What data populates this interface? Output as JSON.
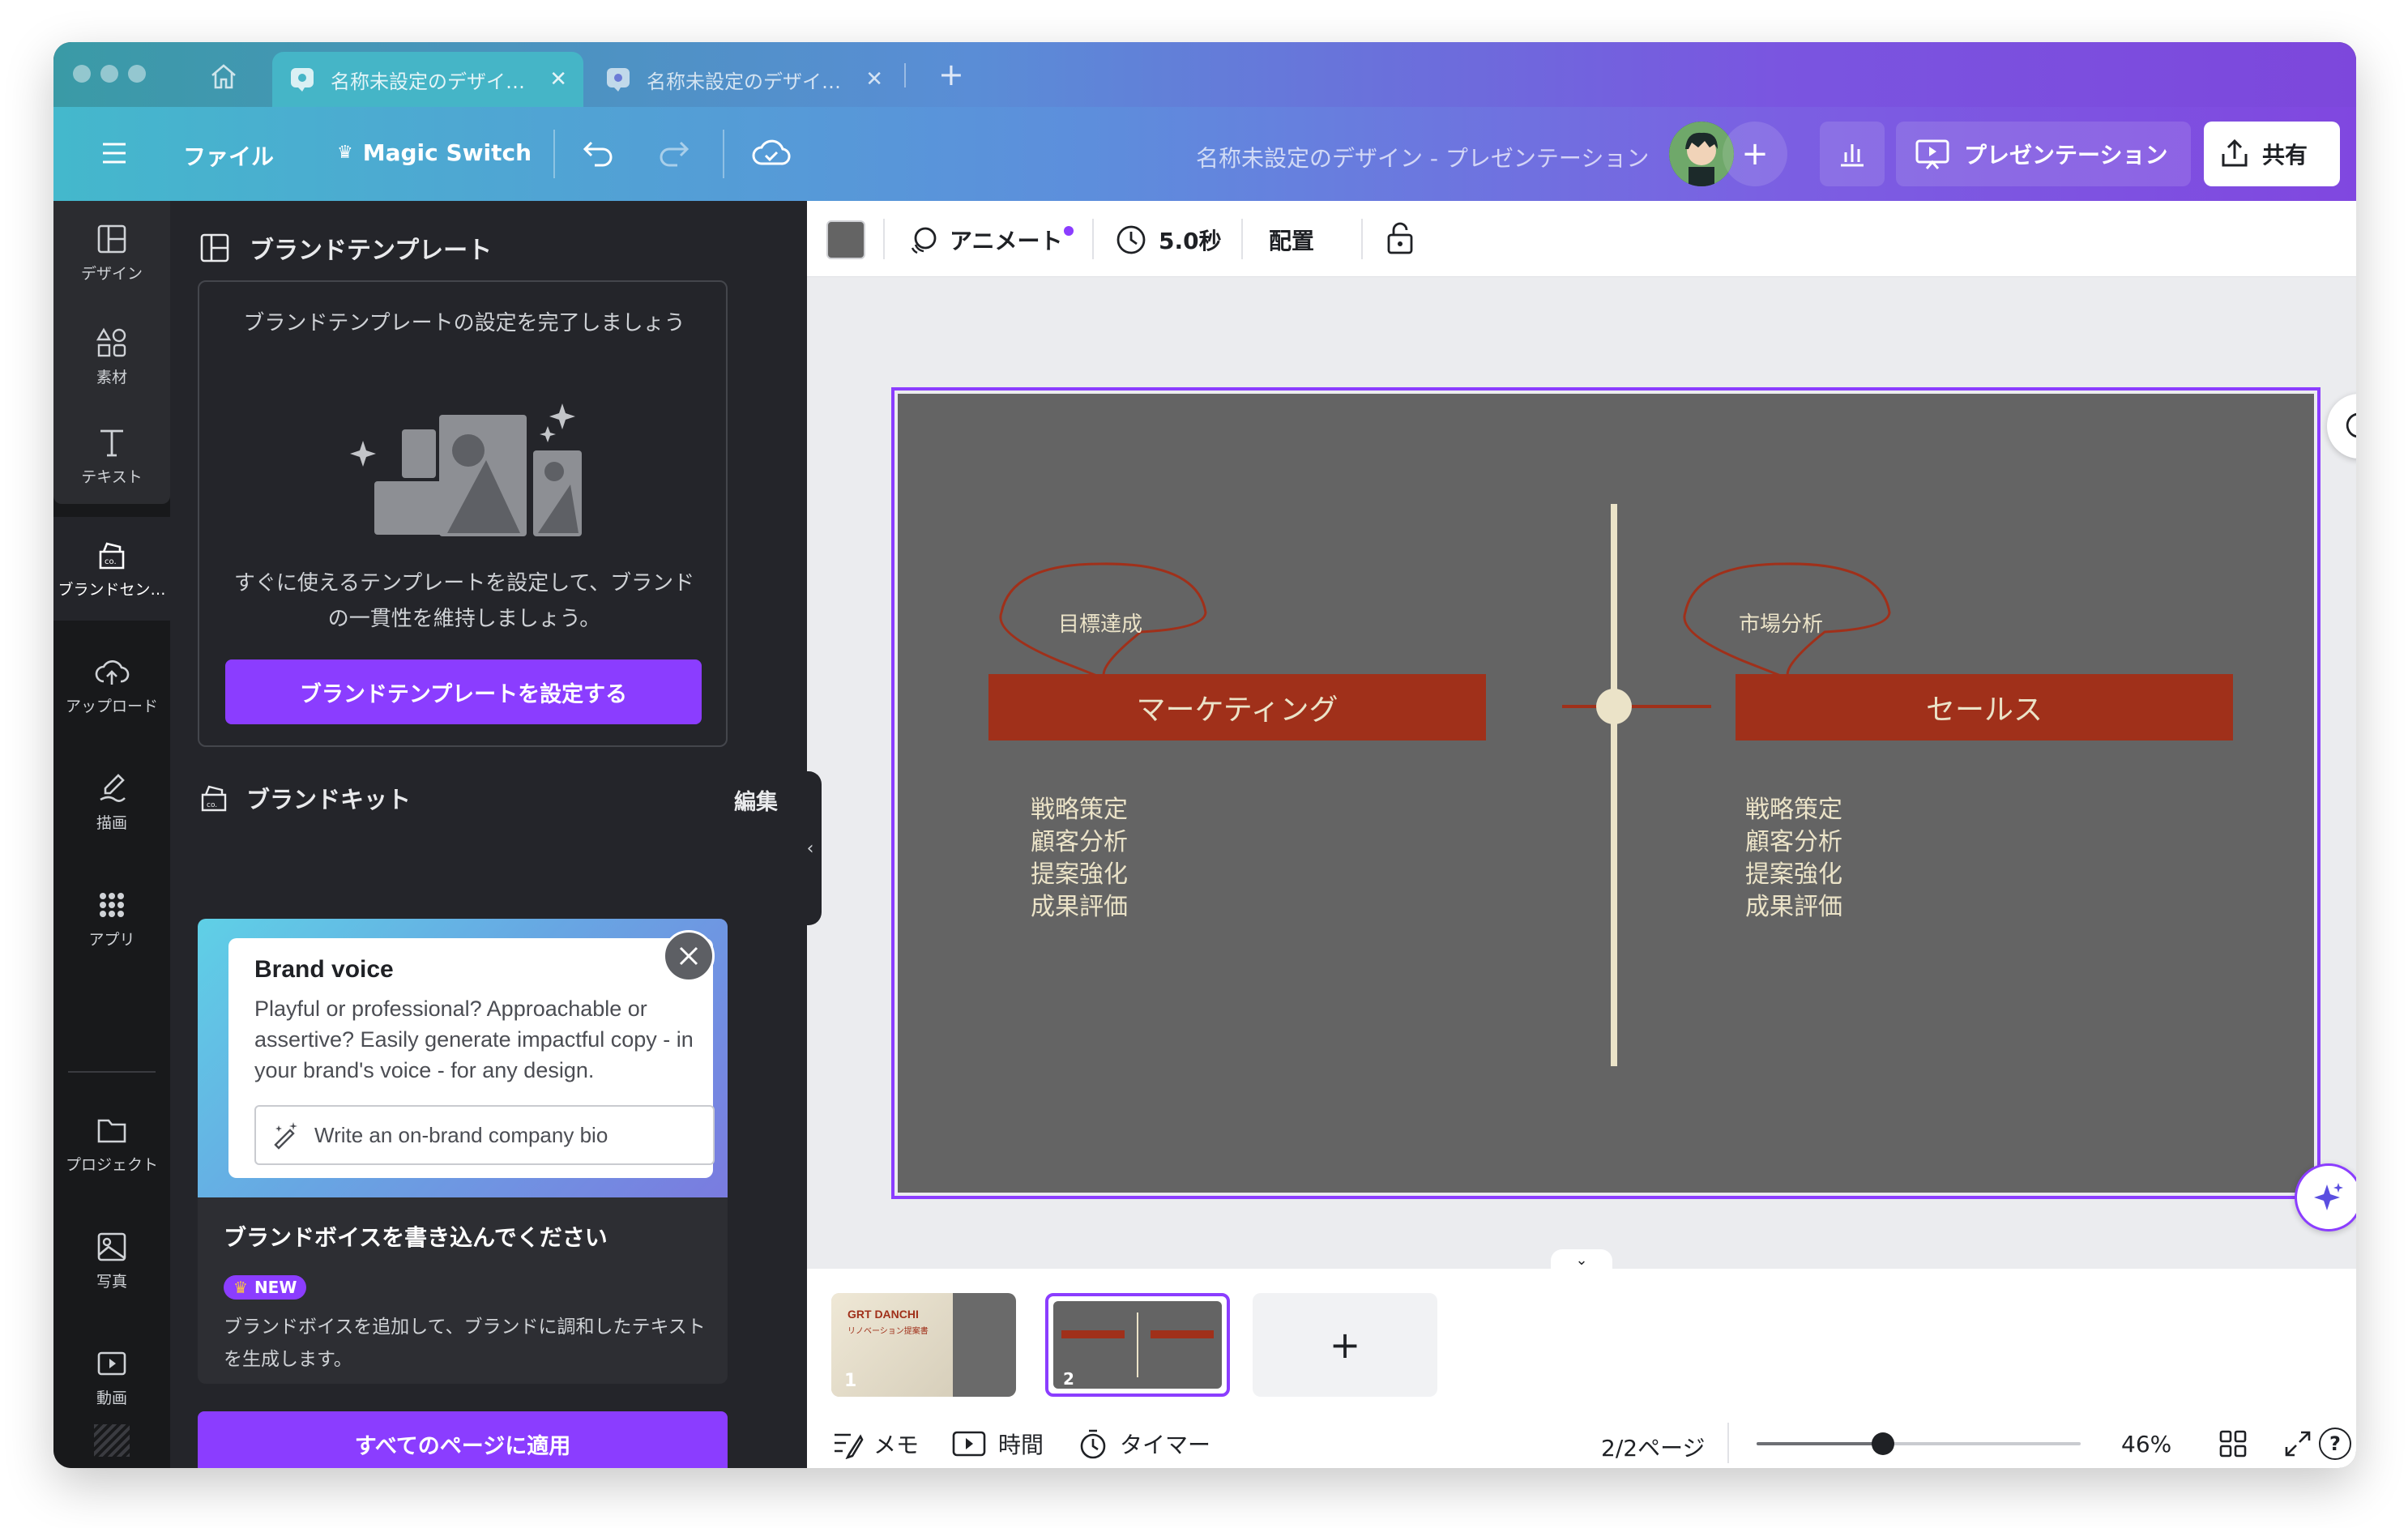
{
  "tabs": [
    {
      "label": "名称未設定のデザイ…",
      "active": true
    },
    {
      "label": "名称未設定のデザイ…",
      "active": false
    }
  ],
  "toolbar": {
    "file_label": "ファイル",
    "magic_switch_label": "Magic Switch",
    "doc_title": "名称未設定のデザイン - プレゼンテーション",
    "present_label": "プレゼンテーション",
    "share_label": "共有"
  },
  "rail": {
    "items": [
      {
        "label": "デザイン",
        "icon": "layout-icon"
      },
      {
        "label": "素材",
        "icon": "shapes-icon"
      },
      {
        "label": "テキスト",
        "icon": "text-icon"
      },
      {
        "label": "ブランドセン…",
        "icon": "brand-icon"
      },
      {
        "label": "アップロード",
        "icon": "upload-icon"
      },
      {
        "label": "描画",
        "icon": "draw-icon"
      },
      {
        "label": "アプリ",
        "icon": "apps-icon"
      },
      {
        "label": "プロジェクト",
        "icon": "folder-icon"
      },
      {
        "label": "写真",
        "icon": "photo-icon"
      },
      {
        "label": "動画",
        "icon": "video-icon"
      }
    ]
  },
  "panel": {
    "header": "ブランドテンプレート",
    "setup_title": "ブランドテンプレートの設定を完了しましょう",
    "setup_desc": "すぐに使えるテンプレートを設定して、ブランドの一貫性を維持しましょう。",
    "setup_button": "ブランドテンプレートを設定する",
    "brand_kit_label": "ブランドキット",
    "edit_label": "編集",
    "voice_card_title": "Brand voice",
    "voice_card_desc": "Playful or professional? Approachable or assertive? Easily generate impactful copy - in your brand's voice - for any design.",
    "voice_card_input": "Write an on-brand company bio",
    "voice_heading": "ブランドボイスを書き込んでください",
    "new_badge": "NEW",
    "voice_desc": "ブランドボイスを追加して、ブランドに調和したテキストを生成します。",
    "apply_button": "すべてのページに適用"
  },
  "context": {
    "animate_label": "アニメート",
    "duration_label": "5.0秒",
    "arrange_label": "配置"
  },
  "slide": {
    "left_bubble": "目標達成",
    "right_bubble": "市場分析",
    "left_header": "マーケティング",
    "right_header": "セールス",
    "left_items": [
      "戦略策定",
      "顧客分析",
      "提案強化",
      "成果評価"
    ],
    "right_items": [
      "戦略策定",
      "顧客分析",
      "提案強化",
      "成果評価"
    ],
    "bg_color": "#646464",
    "accent_color": "#a0301a",
    "line_color": "#ebe3c8"
  },
  "thumbnails": [
    {
      "number": "1",
      "title": "GRT DANCHI",
      "subtitle": "リノベーション提案書"
    },
    {
      "number": "2"
    }
  ],
  "bottom": {
    "memo_label": "メモ",
    "time_label": "時間",
    "timer_label": "タイマー",
    "page_indicator": "2/2ページ",
    "zoom_value": 46,
    "zoom_label": "46%"
  },
  "colors": {
    "brand_purple": "#8b3dff",
    "panel_bg": "#24252a",
    "rail_bg": "#18191b"
  }
}
